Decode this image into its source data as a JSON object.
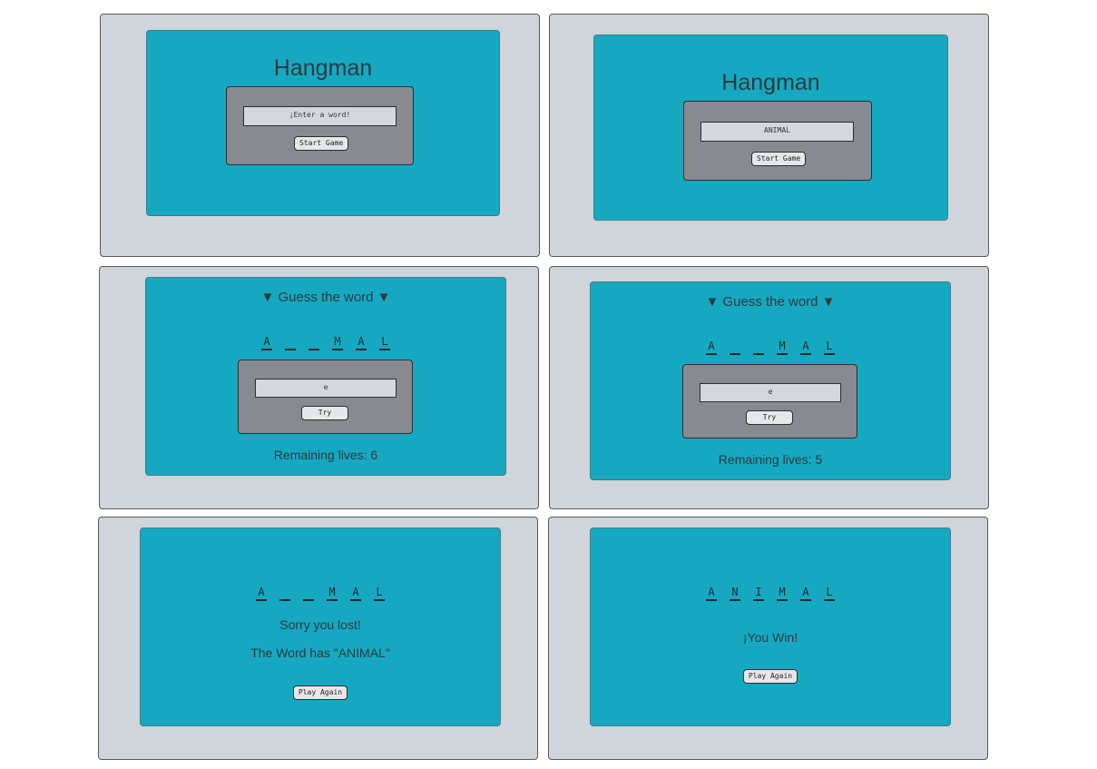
{
  "screens": {
    "s1": {
      "title": "Hangman",
      "input_placeholder": "¡Enter a word!",
      "button": "Start Game"
    },
    "s2": {
      "title": "Hangman",
      "input_value": "ANIMAL",
      "button": "Start Game"
    },
    "s3": {
      "heading": "▼ Guess the word ▼",
      "letters": [
        "A",
        "",
        "",
        "M",
        "A",
        "L"
      ],
      "input_value": "e",
      "button": "Try",
      "lives": "Remaining lives: 6"
    },
    "s4": {
      "heading": "▼ Guess the word ▼",
      "letters": [
        "A",
        "",
        "",
        "M",
        "A",
        "L"
      ],
      "input_value": "e",
      "button": "Try",
      "lives": "Remaining lives: 5"
    },
    "s5": {
      "letters": [
        "A",
        "",
        "",
        "M",
        "A",
        "L"
      ],
      "message": "Sorry you lost!",
      "reveal": "The Word has \"ANIMAL\"",
      "button": "Play Again"
    },
    "s6": {
      "letters": [
        "A",
        "N",
        "I",
        "M",
        "A",
        "L"
      ],
      "message": "¡You Win!",
      "button": "Play Again"
    }
  },
  "colors": {
    "card": "#16a8c1",
    "frame": "#d0d4db",
    "panel": "#878b91"
  }
}
